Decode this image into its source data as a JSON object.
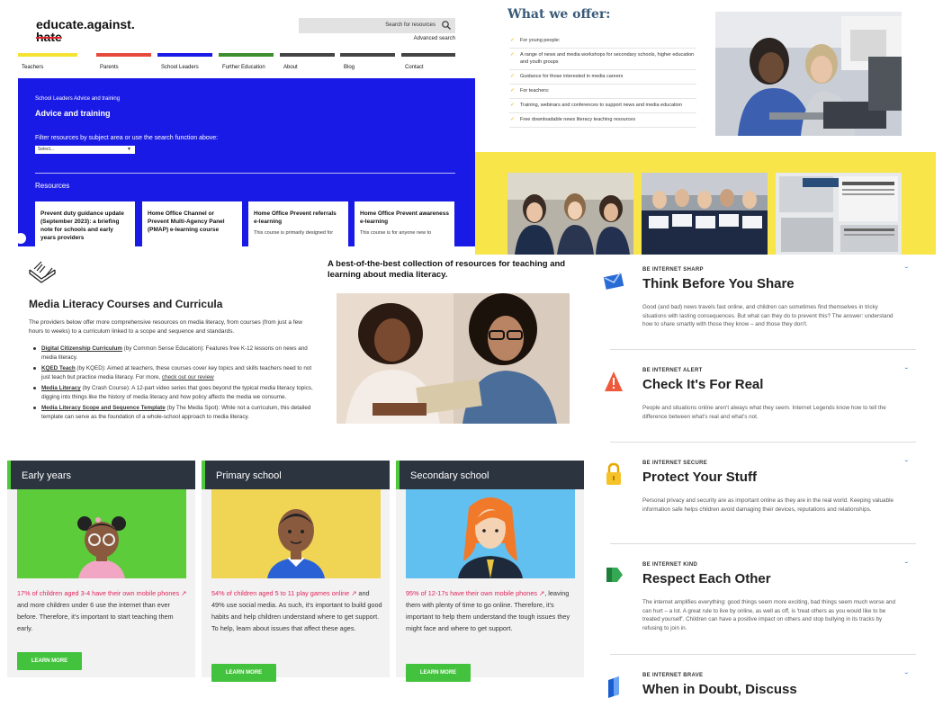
{
  "panel_a": {
    "logo_line1": "educate.against.",
    "logo_line2": "hate",
    "search_placeholder": "Search for resources",
    "advanced_search": "Advanced search",
    "nav": [
      {
        "label": "Teachers",
        "color": "#f5e233"
      },
      {
        "label": "Parents",
        "color": "#e64a3c"
      },
      {
        "label": "School Leaders",
        "color": "#1a1ae6"
      },
      {
        "label": "Further Education",
        "color": "#3d8f2e"
      },
      {
        "label": "About",
        "color": "#444444"
      },
      {
        "label": "Blog",
        "color": "#444444"
      },
      {
        "label": "Contact",
        "color": "#444444"
      }
    ],
    "breadcrumb": "School Leaders Advice and training",
    "heading": "Advice and training",
    "filter_text": "Filter resources by subject area or use the search function above:",
    "select_value": "Select...",
    "resources_label": "Resources",
    "cards": [
      {
        "title": "Prevent duty guidance update (September 2023): a briefing note for schools and early years providers",
        "desc": ""
      },
      {
        "title": "Home Office Channel or Prevent Multi-Agency Panel (PMAP) e-learning course",
        "desc": ""
      },
      {
        "title": "Home Office Prevent referrals e-learning",
        "desc": "This course is primarily designed for"
      },
      {
        "title": "Home Office Prevent awareness e-learning",
        "desc": "This course is for anyone new to"
      }
    ],
    "accent_color": "#1a1ae6"
  },
  "panel_b": {
    "title": "What we offer:",
    "items": [
      "For young people:",
      "A range of news and media workshops for secondary schools, higher education and youth groups",
      "Guidance for those interested in media careers",
      "For teachers:",
      "Training, webinars and conferences to support news and media education",
      "Free downloadable news literacy teaching resources"
    ]
  },
  "panel_c": {
    "heading": "Media Literacy Courses and Curricula",
    "intro": "The providers below offer more comprehensive resources on media literacy, from courses (from just a few hours to weeks) to a curriculum linked to a scope and sequence and standards.",
    "items": [
      {
        "name": "Digital Citizenship Curriculum",
        "rest": " (by Common Sense Education): Features free K-12 lessons on news and media literacy.",
        "link": ""
      },
      {
        "name": "KQED Teach",
        "rest": " (by KQED): Aimed at teachers, these courses cover key topics and skills teachers need to not just teach but practice media literacy. For more, ",
        "link": "check out our review"
      },
      {
        "name": "Media Literacy",
        "rest": " (by Crash Course): A 12-part video series that goes beyond the typical media literacy topics, digging into things like the history of media literacy and how policy affects the media we consume.",
        "link": ""
      },
      {
        "name": "Media Literacy Scope and Sequence Template",
        "rest": " (by The Media Spot): While not a curriculum, this detailed template can serve as the foundation of a whole-school approach to media literacy.",
        "link": ""
      }
    ],
    "tagline": "A best-of-the-best collection of resources for teaching and learning about media literacy."
  },
  "panel_d": {
    "columns": [
      {
        "heading": "Early years",
        "link_text": "17% of children aged 3-4 have their own mobile phones",
        "body": " and more children under 6 use the internet than ever before. Therefore, it's important to start teaching them early.",
        "button": "LEARN MORE",
        "bg": "#5ccc3a"
      },
      {
        "heading": "Primary school",
        "link_text": "54% of children aged 5 to 11 play games online",
        "body": " and 49% use social media. As such, it's important to build good habits and help children understand where to get support. To help, learn about issues that affect these ages.",
        "button": "LEARN MORE",
        "bg": "#f0d454"
      },
      {
        "heading": "Secondary school",
        "link_text": "95% of 12-17s have their own mobile phones",
        "body": ", leaving them with plenty of time to go online. Therefore, it's important to help them understand the tough issues they might face and where to get support.",
        "button": "LEARN MORE",
        "bg": "#62c0f0"
      }
    ]
  },
  "panel_e": {
    "items": [
      {
        "eyebrow": "BE INTERNET SHARP",
        "title": "Think Before You Share",
        "desc": "Good (and bad) news travels fast online, and children can sometimes find themselves in tricky situations with lasting consequences. But what can they do to prevent this? The answer: understand how to share smartly with those they know – and those they don't.",
        "icon": "envelope-icon"
      },
      {
        "eyebrow": "BE INTERNET ALERT",
        "title": "Check It's For Real",
        "desc": "People and situations online aren't always what they seem. Internet Legends know how to tell the difference between what's real and what's not.",
        "icon": "warning-icon"
      },
      {
        "eyebrow": "BE INTERNET SECURE",
        "title": "Protect Your Stuff",
        "desc": "Personal privacy and security are as important online as they are in the real world. Keeping valuable information safe helps children avoid damaging their devices, reputations and relationships.",
        "icon": "padlock-icon"
      },
      {
        "eyebrow": "BE INTERNET KIND",
        "title": "Respect Each Other",
        "desc": "The internet amplifies everything: good things seem more exciting, bad things seem much worse and can hurt – a lot. A great rule to live by online, as well as off, is 'treat others as you would like to be treated yourself'. Children can have a positive impact on others and stop bullying in its tracks by refusing to join in.",
        "icon": "speech-bubble-icon"
      },
      {
        "eyebrow": "BE INTERNET BRAVE",
        "title": "When in Doubt, Discuss",
        "desc": "",
        "icon": "shield-icon"
      }
    ]
  }
}
